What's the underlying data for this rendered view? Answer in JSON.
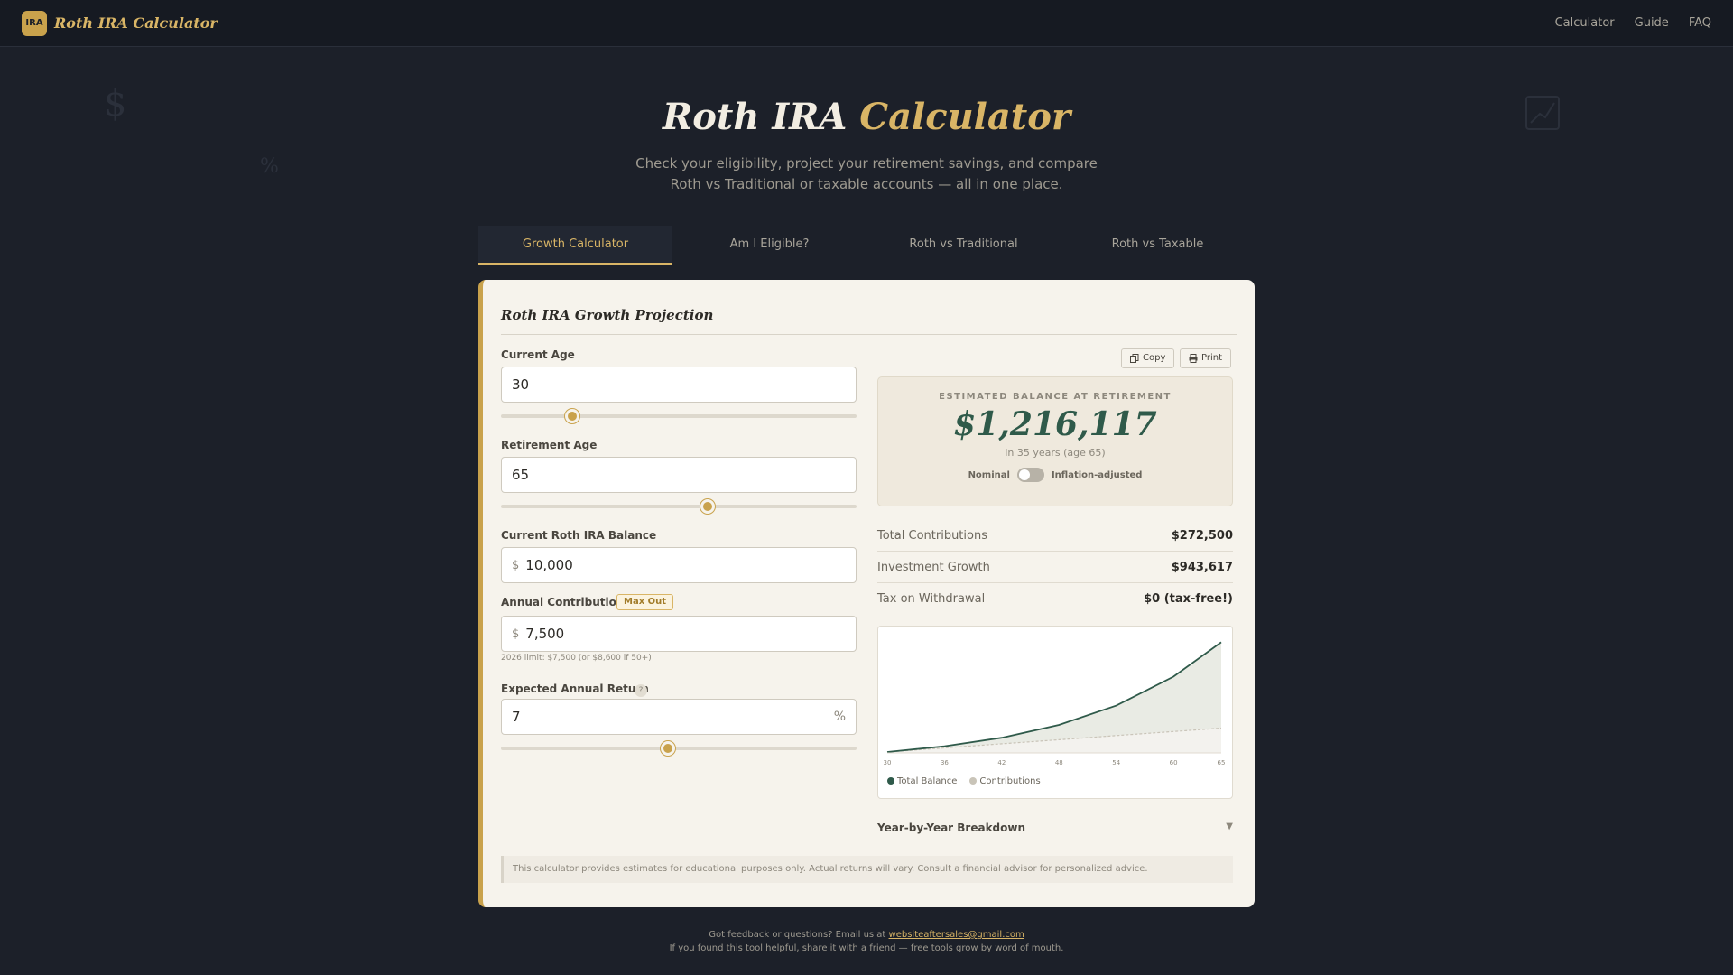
{
  "header": {
    "logo_badge": "IRA",
    "logo_text": "Roth IRA Calculator",
    "nav": [
      "Calculator",
      "Guide",
      "FAQ"
    ]
  },
  "hero": {
    "title_main": "Roth IRA",
    "title_accent": "Calculator",
    "subtitle_line1": "Check your eligibility, project your retirement savings, and compare",
    "subtitle_line2": "Roth vs Traditional or taxable accounts — all in one place."
  },
  "tabs": [
    "Growth Calculator",
    "Am I Eligible?",
    "Roth vs Traditional",
    "Roth vs Taxable"
  ],
  "card": {
    "title": "Roth IRA Growth Projection",
    "current_age_label": "Current Age",
    "current_age": "30",
    "retirement_age_label": "Retirement Age",
    "retirement_age": "65",
    "balance_label": "Current Roth IRA Balance",
    "balance_prefix": "$",
    "balance": "10,000",
    "contribution_label": "Annual Contribution",
    "max_out": "Max Out",
    "contribution_prefix": "$",
    "contribution": "7,500",
    "contribution_hint": "2026 limit: $7,500 (or $8,600 if 50+)",
    "return_label": "Expected Annual Return",
    "return_help": "?",
    "return_value": "7",
    "return_suffix": "%",
    "sliders": {
      "current_age": 0.2,
      "retirement_age": 0.58,
      "return": 0.47
    },
    "copy_label": "Copy",
    "print_label": "Print",
    "result_label": "ESTIMATED BALANCE AT RETIREMENT",
    "result_value": "$1,216,117",
    "result_sub": "in 35 years (age 65)",
    "toggle_left": "Nominal",
    "toggle_right": "Inflation-adjusted",
    "stats": [
      {
        "label": "Total Contributions",
        "value": "$272,500"
      },
      {
        "label": "Investment Growth",
        "value": "$943,617"
      },
      {
        "label": "Tax on Withdrawal",
        "value": "$0 (tax-free!)"
      }
    ],
    "breakdown_label": "Year-by-Year Breakdown",
    "breakdown_icon": "▼",
    "disclaimer": "This calculator provides estimates for educational purposes only. Actual returns will vary. Consult a financial advisor for personalized advice."
  },
  "chart_data": {
    "type": "area",
    "x": [
      30,
      36,
      42,
      48,
      54,
      60,
      65
    ],
    "x_ticks": [
      "30",
      "36",
      "42",
      "48",
      "54",
      "60",
      "65"
    ],
    "series": [
      {
        "name": "Total Balance",
        "values": [
          10000,
          73000,
          167000,
          308000,
          520000,
          838000,
          1216117
        ]
      },
      {
        "name": "Contributions",
        "values": [
          10000,
          55000,
          100000,
          145000,
          190000,
          235000,
          272500
        ]
      }
    ],
    "ylim": [
      0,
      1250000
    ],
    "colors": {
      "balance": "#2f5a4a",
      "contributions": "#b7b2a7"
    }
  },
  "footer": {
    "line1_prefix": "Got feedback or questions? Email us at ",
    "email": "websiteaftersales@gmail.com",
    "line2": "If you found this tool helpful, share it with a friend — free tools grow by word of mouth."
  }
}
